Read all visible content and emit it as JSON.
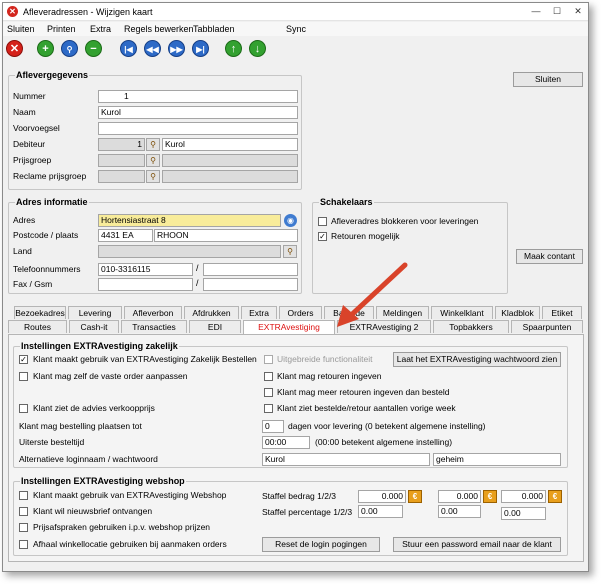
{
  "window": {
    "title": "Afleveradressen - Wijzigen kaart",
    "controls": [
      "—",
      "☐",
      "✕"
    ]
  },
  "menu": [
    "Sluiten",
    "Printen",
    "Extra",
    "Regels bewerken",
    "Tabbladen",
    "Sync"
  ],
  "toolbar": {
    "icons": [
      "cancel-icon",
      "add-icon",
      "search-icon",
      "remove-icon",
      "first-icon",
      "prev-icon",
      "next-icon",
      "last-icon",
      "up-icon",
      "down-icon"
    ],
    "glyphs": [
      "✕",
      "+",
      "⚲",
      "−",
      "|◀",
      "◀◀",
      "▶▶",
      "▶|",
      "↑",
      "↓"
    ]
  },
  "buttons": {
    "sluiten": "Sluiten",
    "maak_contant": "Maak contant",
    "wachtwoord": "Laat het EXTRAvestiging wachtwoord zien",
    "reset": "Reset de login pogingen",
    "stuur": "Stuur een password email naar de klant"
  },
  "afleveradres": {
    "title": "Aflevergegevens",
    "nummer_label": "Nummer",
    "nummer": "1",
    "naam_label": "Naam",
    "naam": "Kurol",
    "voorvoegsel_label": "Voorvoegsel",
    "voorvoegsel": "",
    "debiteur_label": "Debiteur",
    "debiteur": "1",
    "debiteur_naam": "Kurol",
    "prijsgroep_label": "Prijsgroep",
    "reclame_label": "Reclame prijsgroep"
  },
  "adres": {
    "title": "Adres informatie",
    "adres_label": "Adres",
    "adres": "Hortensiastraat 8",
    "postcode_label": "Postcode / plaats",
    "postcode": "4431 EA",
    "plaats": "RHOON",
    "land_label": "Land",
    "land": "",
    "telefoon_label": "Telefoonnummers",
    "telefoon": "010-3316115",
    "telefoon2": "",
    "fax_label": "Fax / Gsm",
    "fax": "",
    "gsm": ""
  },
  "schakelaars": {
    "title": "Schakelaars",
    "blokkeren": "Afleveradres blokkeren voor leveringen",
    "retouren": "Retouren mogelijk"
  },
  "tabs_row1": [
    "Bezoekadres",
    "Levering",
    "Afleverbon",
    "Afdrukken",
    "Extra",
    "Orders",
    "Barcode",
    "Meldingen",
    "Winkelklant",
    "Kladblok",
    "Etiket"
  ],
  "tabs_row2": [
    "Routes",
    "Cash-it",
    "Transacties",
    "EDI",
    "EXTRAvestiging",
    "EXTRAvestiging 2",
    "Topbakkers",
    "Spaarpunten"
  ],
  "zakelijk": {
    "title": "Instellingen EXTRAvestiging zakelijk",
    "c1": "Klant maakt gebruik van EXTRAvestiging Zakelijk Bestellen",
    "c2": "Uitgebreide functionaliteit",
    "c3": "Klant mag zelf de vaste order aanpassen",
    "c4": "Klant mag retouren ingeven",
    "c5": "Klant mag meer retouren ingeven dan besteld",
    "c6": "Klant ziet de advies verkoopprijs",
    "c7": "Klant ziet bestelde/retour aantallen vorige week",
    "plaatsen_label": "Klant mag bestelling plaatsen tot",
    "plaatsen": "0",
    "plaatsen_suffix": "dagen voor levering (0 betekent algemene instelling)",
    "uiterste_label": "Uiterste besteltijd",
    "uiterste": "00:00",
    "uiterste_suffix": "(00:00 betekent algemene instelling)",
    "alt_label": "Alternatieve loginnaam / wachtwoord",
    "login": "Kurol",
    "wachtwoord": "geheim"
  },
  "webshop": {
    "title": "Instellingen EXTRAvestiging webshop",
    "c1": "Klant maakt gebruik van EXTRAvestiging Webshop",
    "c2": "Klant wil nieuwsbrief ontvangen",
    "c3": "Prijsafspraken gebruiken i.p.v. webshop prijzen",
    "c4": "Afhaal winkellocatie gebruiken bij aanmaken orders",
    "staffel_bedrag": "Staffel bedrag 1/2/3",
    "staffel_pct": "Staffel percentage 1/2/3",
    "bedrag": [
      "0.000",
      "0.000",
      "0.000"
    ],
    "pct": [
      "0.00",
      "0.00",
      "0.00"
    ],
    "euro": "€"
  }
}
